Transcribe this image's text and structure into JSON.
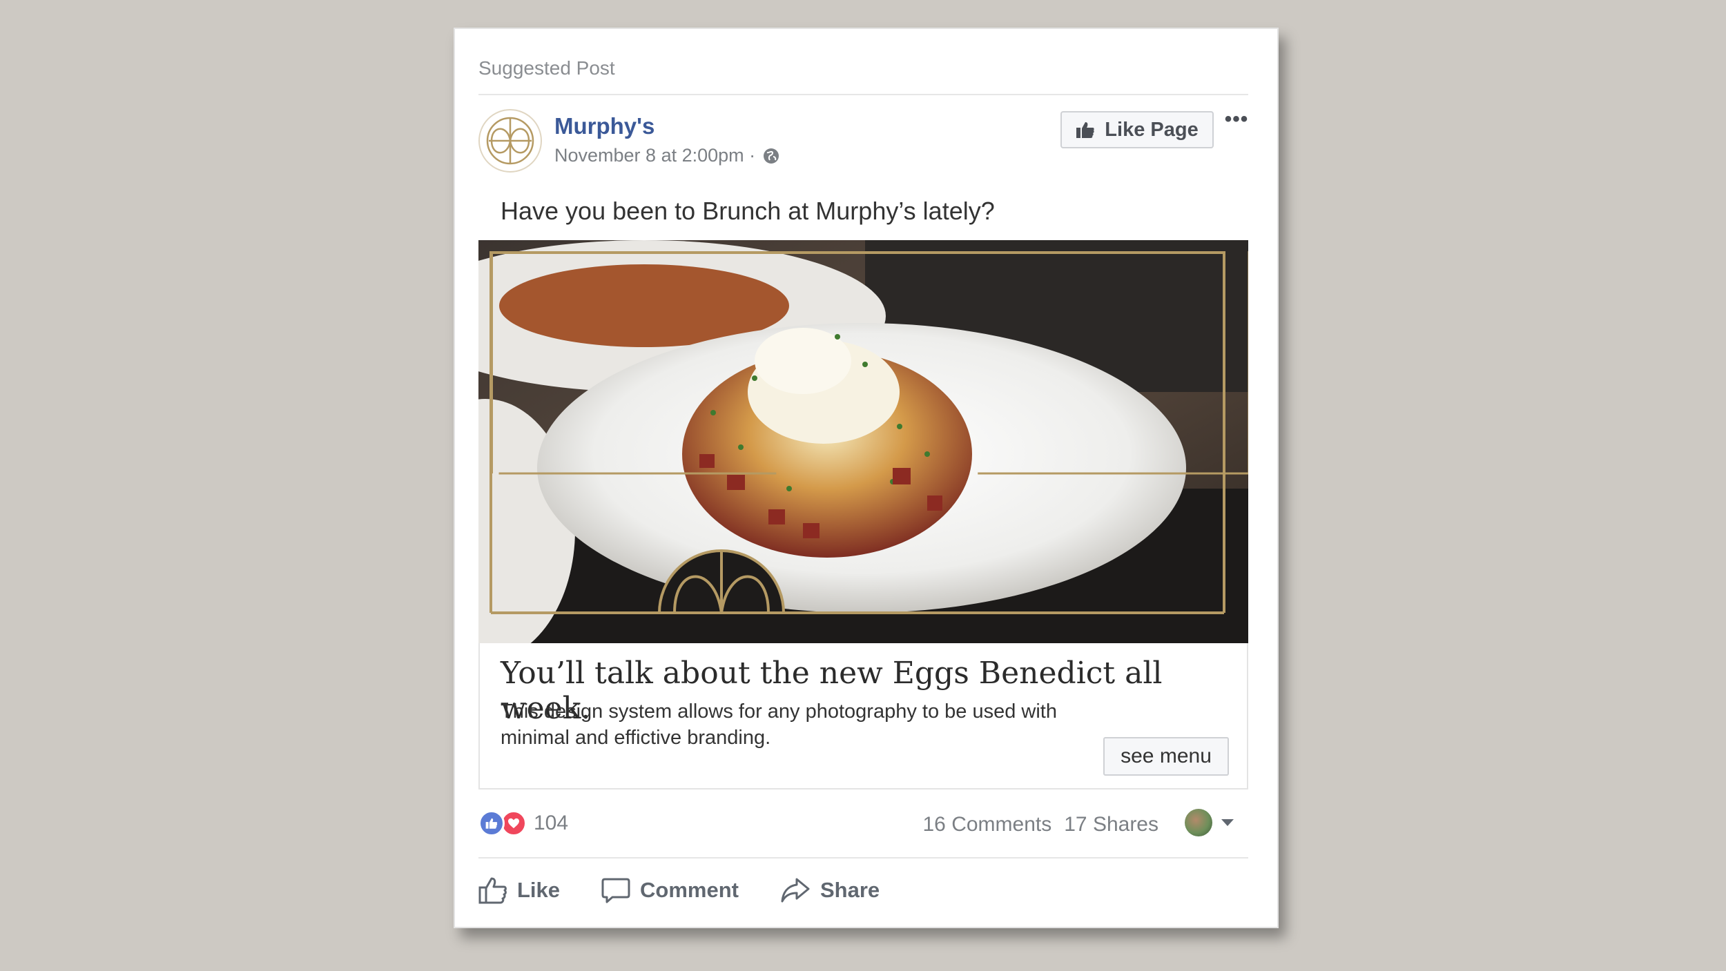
{
  "post": {
    "label": "Suggested Post",
    "page_name": "Murphy's",
    "timestamp": "November 8 at 2:00pm ·",
    "like_page_label": "Like Page",
    "more_label": "•••",
    "text": "Have you been to Brunch at Murphy’s lately?"
  },
  "link": {
    "headline": "You’ll talk about the new Eggs Benedict all week.",
    "description": "This design system allows for any photography to be used with minimal and effictive branding.",
    "cta_label": "see menu"
  },
  "stats": {
    "reaction_count": "104",
    "comments": "16 Comments",
    "shares": "17 Shares"
  },
  "actions": {
    "like": "Like",
    "comment": "Comment",
    "share": "Share"
  },
  "colors": {
    "page_background": "#cdc9c3",
    "brand_blue": "#3b5998",
    "gold_accent": "#b59a63",
    "like_blue": "#5b7bd5",
    "love_red": "#f0475c"
  },
  "icons": [
    "murphys-logo",
    "globe-icon",
    "thumbs-up-icon",
    "more-icon",
    "heart-icon",
    "comment-icon",
    "share-icon",
    "chevron-down-icon"
  ]
}
